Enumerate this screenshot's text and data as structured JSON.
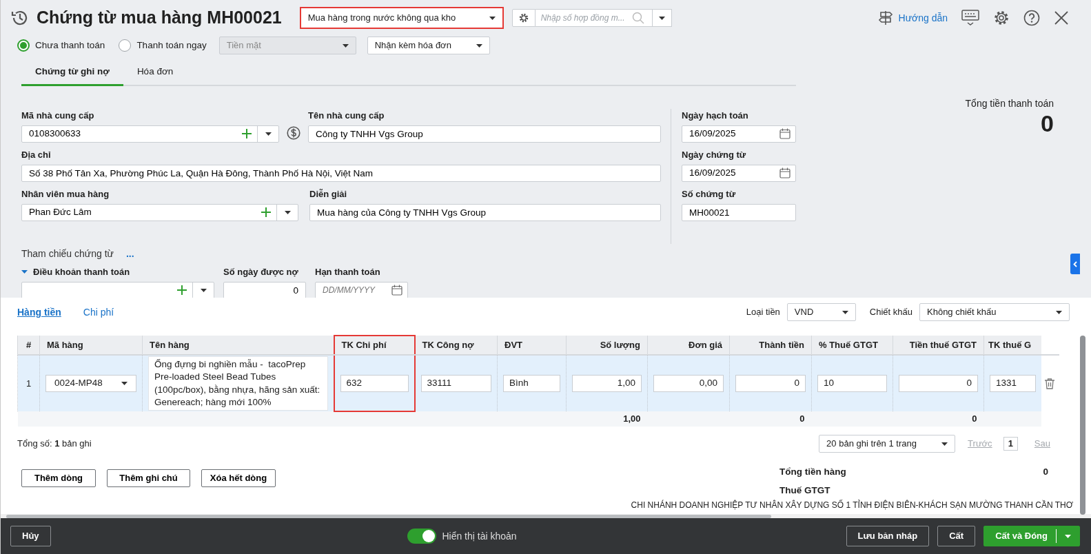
{
  "title": "Chứng từ mua hàng MH00021",
  "voucher_type": {
    "value": "Mua hàng trong nước không qua kho",
    "highlighted": true
  },
  "contract_search": {
    "placeholder": "Nhập số hợp đồng m..."
  },
  "guide_link": "Hướng dẫn",
  "payment_status": [
    {
      "label": "Chưa thanh toán",
      "selected": true
    },
    {
      "label": "Thanh toán ngay",
      "selected": false
    }
  ],
  "payment_method": {
    "value": "Tiền mặt",
    "disabled": true
  },
  "invoice_option": {
    "value": "Nhận kèm hóa đơn"
  },
  "tabs": [
    {
      "label": "Chứng từ ghi nợ",
      "selected": true
    },
    {
      "label": "Hóa đơn",
      "selected": false
    }
  ],
  "supplier_code": {
    "label": "Mã nhà cung cấp",
    "value": "0108300633"
  },
  "supplier_name": {
    "label": "Tên nhà cung cấp",
    "value": "Công ty TNHH Vgs Group"
  },
  "address": {
    "label": "Địa chỉ",
    "value": "Số 38 Phố Tân Xa, Phường Phúc La, Quận Hà Đông, Thành Phố Hà Nội, Việt Nam"
  },
  "purchaser": {
    "label": "Nhân viên mua hàng",
    "value": "Phan Đức Lâm"
  },
  "description": {
    "label": "Diễn giải",
    "value": "Mua hàng của Công ty TNHH Vgs Group"
  },
  "posting_date": {
    "label": "Ngày hạch toán",
    "value": "16/09/2025"
  },
  "voucher_date": {
    "label": "Ngày chứng từ",
    "value": "16/09/2025"
  },
  "voucher_no": {
    "label": "Số chứng từ",
    "value": "MH00021"
  },
  "total_payment": {
    "label": "Tổng tiền thanh toán",
    "value": "0"
  },
  "reference": {
    "label": "Tham chiếu chứng từ",
    "more": "..."
  },
  "payment_terms": {
    "label": "Điều khoản thanh toán",
    "expanded": true
  },
  "credit_days": {
    "label": "Số ngày được nợ",
    "value": "0"
  },
  "due_date": {
    "label": "Hạn thanh toán",
    "placeholder": "DD/MM/YYYY"
  },
  "detail_tabs": [
    {
      "label": "Hàng tiền",
      "selected": true
    },
    {
      "label": "Chi phí",
      "selected": false
    }
  ],
  "currency": {
    "label": "Loại tiền",
    "value": "VND"
  },
  "discount": {
    "label": "Chiết khấu",
    "value": "Không chiết khấu"
  },
  "table": {
    "columns": [
      {
        "label": "#",
        "numeric": true
      },
      {
        "label": "Mã hàng",
        "numeric": false
      },
      {
        "label": "Tên hàng",
        "numeric": false
      },
      {
        "label": "TK Chi phí",
        "numeric": false,
        "highlighted": true
      },
      {
        "label": "TK Công nợ",
        "numeric": false
      },
      {
        "label": "ĐVT",
        "numeric": false
      },
      {
        "label": "Số lượng",
        "numeric": true,
        "total": "1,00"
      },
      {
        "label": "Đơn giá",
        "numeric": true
      },
      {
        "label": "Thành tiền",
        "numeric": true,
        "total": "0"
      },
      {
        "label": "% Thuế GTGT",
        "numeric": false
      },
      {
        "label": "Tiền thuế GTGT",
        "numeric": true,
        "total": "0"
      },
      {
        "label": "TK thuế G",
        "numeric": false
      }
    ],
    "rows": [
      {
        "selected": true,
        "cells": [
          {
            "kind": "index",
            "text": "1"
          },
          {
            "kind": "select",
            "text": "0024-MP48"
          },
          {
            "kind": "textarea",
            "text": "Ống đựng bi nghiền mẫu -  tacoPrep Pre-loaded Steel Bead Tubes (100pc/box), bằng nhựa, hãng sản xuất: Genereach; hàng mới 100%"
          },
          {
            "kind": "input",
            "text": "632"
          },
          {
            "kind": "input",
            "text": "33111"
          },
          {
            "kind": "input",
            "text": "Bình"
          },
          {
            "kind": "input",
            "text": "1,00"
          },
          {
            "kind": "input",
            "text": "0,00"
          },
          {
            "kind": "input",
            "text": "0"
          },
          {
            "kind": "input",
            "text": "10"
          },
          {
            "kind": "input",
            "text": "0"
          },
          {
            "kind": "input",
            "text": "1331"
          }
        ]
      }
    ]
  },
  "record_count": "Tổng số: **1** bản ghi",
  "page_size": "20 bản ghi trên 1 trang",
  "pager": {
    "prev": "Trước",
    "page": "1",
    "next": "Sau",
    "prev_disabled": true,
    "next_disabled": true
  },
  "row_buttons": [
    "Thêm dòng",
    "Thêm ghi chú",
    "Xóa hết dòng"
  ],
  "summary": [
    {
      "label": "Tổng tiền hàng",
      "value": "0"
    },
    {
      "label": "Thuế GTGT"
    }
  ],
  "company_line": "CHI NHÁNH DOANH NGHIỆP TƯ NHÂN XÂY DỰNG SỐ 1 TỈNH ĐIỆN BIÊN-KHÁCH SẠN MƯỜNG THANH CẦN THƠ",
  "footer": {
    "cancel": "Hủy",
    "toggle": {
      "label": "Hiển thị tài khoản",
      "on": true
    },
    "buttons": [
      {
        "label": "Lưu bản nháp",
        "primary": false
      },
      {
        "label": "Cất",
        "primary": false
      },
      {
        "label": "Cất và Đóng",
        "primary": true
      }
    ]
  }
}
